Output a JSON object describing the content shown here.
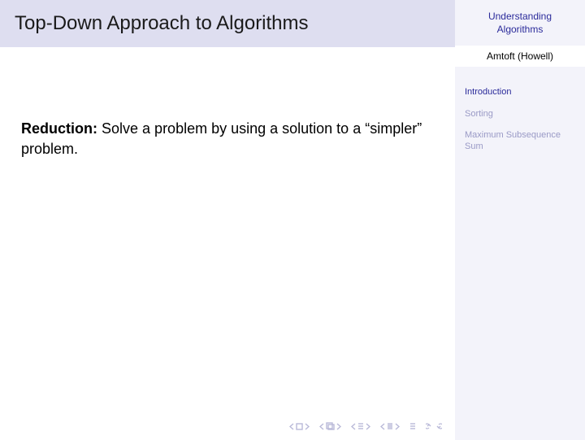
{
  "header": {
    "title": "Top-Down Approach to Algorithms"
  },
  "body": {
    "term": "Reduction:",
    "definition": "Solve a problem by using a solution to a “simpler” problem."
  },
  "sidebar": {
    "title_line1": "Understanding",
    "title_line2": "Algorithms",
    "author": "Amtoft (Howell)",
    "items": [
      {
        "label": "Introduction",
        "active": true
      },
      {
        "label": "Sorting",
        "active": false
      },
      {
        "label": "Maximum Subsequence Sum",
        "active": false
      }
    ]
  }
}
